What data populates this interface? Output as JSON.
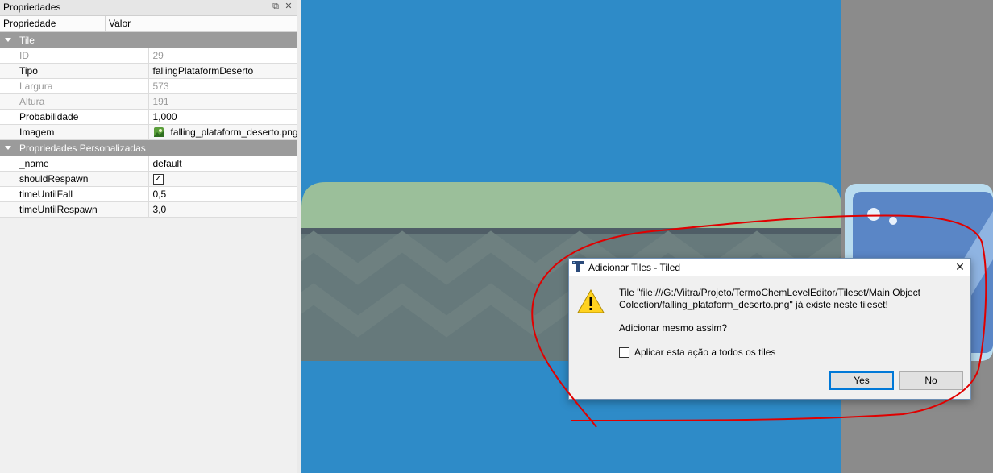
{
  "panel": {
    "title": "Propriedades",
    "columns": {
      "property": "Propriedade",
      "value": "Valor"
    }
  },
  "groups": {
    "tile": "Tile",
    "custom": "Propriedades Personalizadas"
  },
  "tile_props": [
    {
      "key": "ID",
      "value": "29"
    },
    {
      "key": "Tipo",
      "value": "fallingPlataformDeserto"
    },
    {
      "key": "Largura",
      "value": "573"
    },
    {
      "key": "Altura",
      "value": "191"
    },
    {
      "key": "Probabilidade",
      "value": "1,000"
    },
    {
      "key": "Imagem",
      "value": "falling_plataform_deserto.png"
    }
  ],
  "custom_props": [
    {
      "key": "_name",
      "value": "default"
    },
    {
      "key": "shouldRespawn",
      "value": "✓"
    },
    {
      "key": "timeUntilFall",
      "value": "0,5"
    },
    {
      "key": "timeUntilRespawn",
      "value": "3,0"
    }
  ],
  "dialog": {
    "title": "Adicionar Tiles - Tiled",
    "message_line1": "Tile \"file:///G:/Viitra/Projeto/TermoChemLevelEditor/Tileset/Main Object",
    "message_line2": "Colection/falling_plataform_deserto.png\" já existe neste tileset!",
    "question": "Adicionar mesmo assim?",
    "checkbox_label": "Aplicar esta ação a todos os tiles",
    "yes": "Yes",
    "no": "No"
  },
  "colors": {
    "canvas_bg": "#2e8bc8",
    "platform_top": "#9bbf9a",
    "platform_body": "#66797b",
    "group_header": "#9b9b9b",
    "annotation": "#e00000"
  }
}
